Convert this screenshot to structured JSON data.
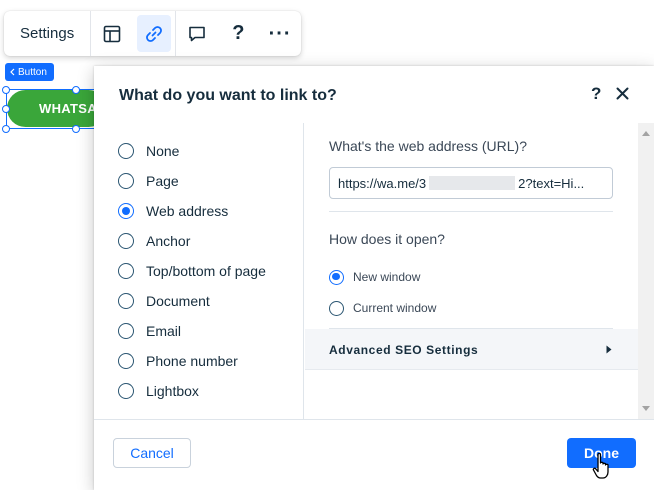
{
  "toolbar": {
    "settings_label": "Settings",
    "icons": [
      "layout-icon",
      "link-icon",
      "comment-icon",
      "help-icon",
      "more-icon"
    ],
    "help_glyph": "?",
    "more_glyph": "···"
  },
  "canvas": {
    "tag_label": "Button",
    "button_text": "WHATSAPP"
  },
  "dialog": {
    "title": "What do you want to link to?",
    "help_glyph": "?",
    "options": [
      {
        "label": "None",
        "selected": false
      },
      {
        "label": "Page",
        "selected": false
      },
      {
        "label": "Web address",
        "selected": true
      },
      {
        "label": "Anchor",
        "selected": false
      },
      {
        "label": "Top/bottom of page",
        "selected": false
      },
      {
        "label": "Document",
        "selected": false
      },
      {
        "label": "Email",
        "selected": false
      },
      {
        "label": "Phone number",
        "selected": false
      },
      {
        "label": "Lightbox",
        "selected": false
      }
    ],
    "url_question": "What's the web address (URL)?",
    "url_value_start": "https://wa.me/3",
    "url_value_end": "2?text=Hi...",
    "open_question": "How does it open?",
    "open_options": [
      {
        "label": "New window",
        "selected": true
      },
      {
        "label": "Current window",
        "selected": false
      }
    ],
    "seo_label": "Advanced SEO Settings",
    "cancel_label": "Cancel",
    "done_label": "Done"
  },
  "colors": {
    "accent": "#116dff",
    "button_green": "#3aa63a",
    "text": "#162d3d"
  }
}
